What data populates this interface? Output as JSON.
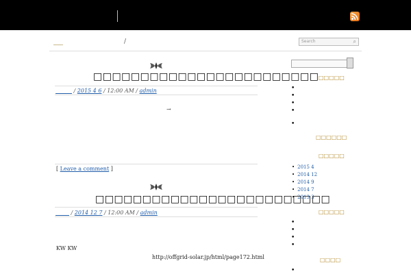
{
  "header": {
    "rss_icon": "rss-icon"
  },
  "nav": {
    "separator": "/"
  },
  "search_top": {
    "placeholder": "Search"
  },
  "posts": [
    {
      "title": "□□□□□□□□□□□□□□□□□□□□□□□□",
      "meta_cat": "______",
      "meta_date": "2015 4 6",
      "meta_time": "/ 12:00 AM /",
      "meta_author": "admin",
      "arrow": "→",
      "comment_open": "[",
      "comment_label": "Leave a comment",
      "comment_close": "]"
    },
    {
      "title": "□□□□□□□□□□□□□□□□□□□□□□□□□",
      "meta_cat": "_____",
      "meta_date": "2014 12 7",
      "meta_time": "/ 12:00 AM /",
      "meta_author": "admin",
      "text": "KW    KW",
      "url": "http://offgrid-solar.jp/html/page172.html"
    }
  ],
  "sidebar": {
    "head1": "□□□□□",
    "head2": "□□□□□□",
    "head3": "□□□□□",
    "archives": [
      "2015 4",
      "2014 12",
      "2014 9",
      "2014 7",
      "2013 3"
    ],
    "head4": "□□□□□",
    "head5": "□□□□"
  }
}
